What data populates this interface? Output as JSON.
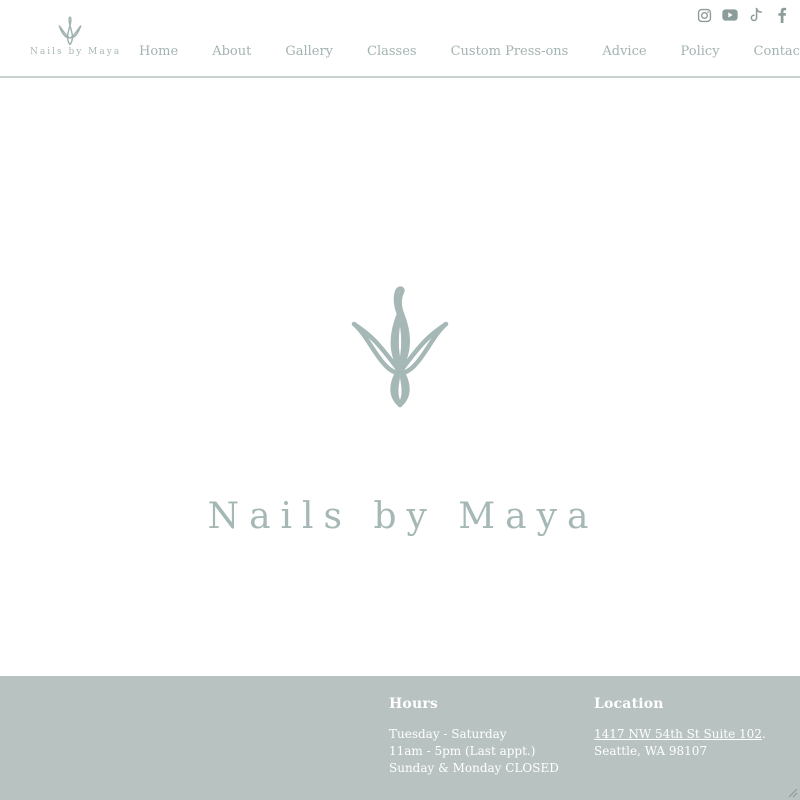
{
  "header": {
    "logo_text": "Nails by Maya",
    "nav": [
      {
        "label": "Home"
      },
      {
        "label": "About"
      },
      {
        "label": "Gallery"
      },
      {
        "label": "Classes"
      },
      {
        "label": "Custom Press-ons"
      },
      {
        "label": "Advice"
      },
      {
        "label": "Policy"
      },
      {
        "label": "Contact"
      }
    ],
    "social_icons": [
      "instagram-icon",
      "youtube-icon",
      "tiktok-icon",
      "facebook-icon"
    ]
  },
  "hero": {
    "title": "Nails by Maya"
  },
  "footer": {
    "hours": {
      "heading": "Hours",
      "lines": [
        "Tuesday - Saturday",
        "11am - 5pm (Last appt.)",
        "Sunday & Monday CLOSED"
      ]
    },
    "location": {
      "heading": "Location",
      "address_link": "1417 NW 54th St Suite 102",
      "address_suffix": ".",
      "city_line": "Seattle, WA 98107"
    }
  },
  "colors": {
    "accent": "#a5b8b6",
    "footer_bg": "#b7c2c1",
    "nav_text": "#a3b3b1",
    "icon": "#8c9c9a"
  }
}
